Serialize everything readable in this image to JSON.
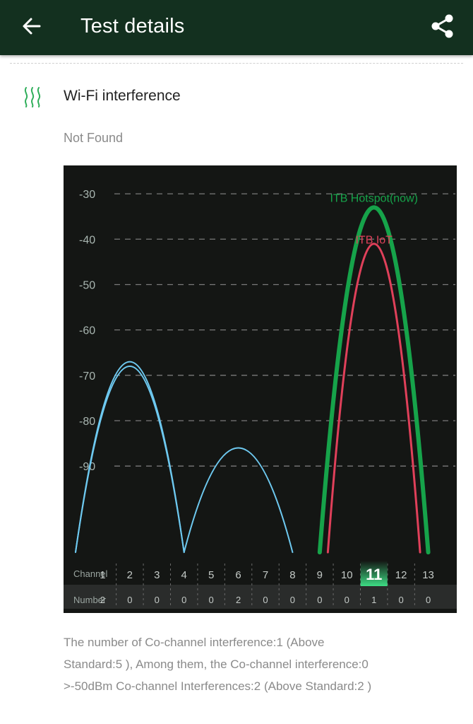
{
  "appbar": {
    "title": "Test details",
    "back_icon": "arrow-left-icon",
    "share_icon": "share-icon",
    "bg_color": "#13301f"
  },
  "section": {
    "icon": "wifi-interference-icon",
    "title": "Wi-Fi interference",
    "status": "Not Found"
  },
  "chart_data": {
    "type": "area",
    "y_ticks": [
      "-30",
      "-40",
      "-50",
      "-60",
      "-70",
      "-80",
      "-90"
    ],
    "ylim": [
      -111,
      -25
    ],
    "xlim": [
      0,
      14
    ],
    "row_labels": {
      "channel": "Channel",
      "number": "Number"
    },
    "channels": [
      "1",
      "2",
      "3",
      "4",
      "5",
      "6",
      "7",
      "8",
      "9",
      "10",
      "11",
      "12",
      "13"
    ],
    "counts": [
      "2",
      "0",
      "0",
      "0",
      "0",
      "2",
      "0",
      "0",
      "0",
      "0",
      "1",
      "0",
      "0"
    ],
    "highlight_channel": "11",
    "grid": true,
    "series": [
      {
        "name": "",
        "center": 2,
        "width": 4,
        "peak": -67,
        "color": "#6ec9f0",
        "stroke": 2
      },
      {
        "name": "",
        "center": 2,
        "width": 4,
        "peak": -68,
        "color": "#6ec9f0",
        "stroke": 2
      },
      {
        "name": "",
        "center": 6,
        "width": 4,
        "peak": -86,
        "color": "#6ec9f0",
        "stroke": 2
      },
      {
        "name": "ITB Hotspot(now)",
        "center": 11,
        "width": 4,
        "peak": -33,
        "color": "#16a34a",
        "stroke": 6
      },
      {
        "name": "ITB IoT",
        "center": 11,
        "width": 3.4,
        "peak": -41,
        "color": "#e0405a",
        "stroke": 3
      }
    ]
  },
  "footer": {
    "line1": "The number of Co-channel interference:1 (Above",
    "line2": "Standard:5 ), Among them, the Co-channel interference:0",
    "line3": ">-50dBm Co-channel Interferences:2 (Above Standard:2 )"
  }
}
